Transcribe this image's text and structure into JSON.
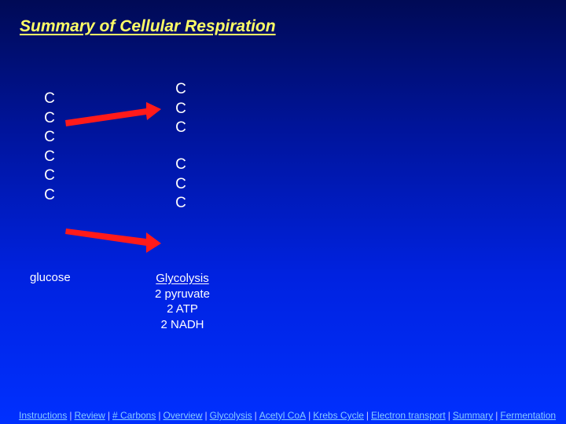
{
  "title": "Summary of Cellular Respiration",
  "diagram": {
    "glucose_carbons": [
      "C",
      "C",
      "C",
      "C",
      "C",
      "C"
    ],
    "pyruvate_1_carbons": [
      "C",
      "C",
      "C"
    ],
    "pyruvate_2_carbons": [
      "C",
      "C",
      "C"
    ],
    "arrow_color": "#ff1a1a",
    "glucose_label": "glucose",
    "glycolysis": {
      "heading": "Glycolysis",
      "products": [
        "2 pyruvate",
        "2 ATP",
        "2 NADH"
      ]
    }
  },
  "colors": {
    "title": "#ffff66",
    "link": "#88ccff",
    "text": "#ffffff"
  },
  "nav": {
    "separator": "|",
    "links": [
      "Instructions",
      "Review",
      "# Carbons",
      "Overview",
      "Glycolysis",
      "Acetyl CoA",
      "Krebs Cycle",
      "Electron transport",
      "Summary",
      "Fermentation"
    ]
  }
}
